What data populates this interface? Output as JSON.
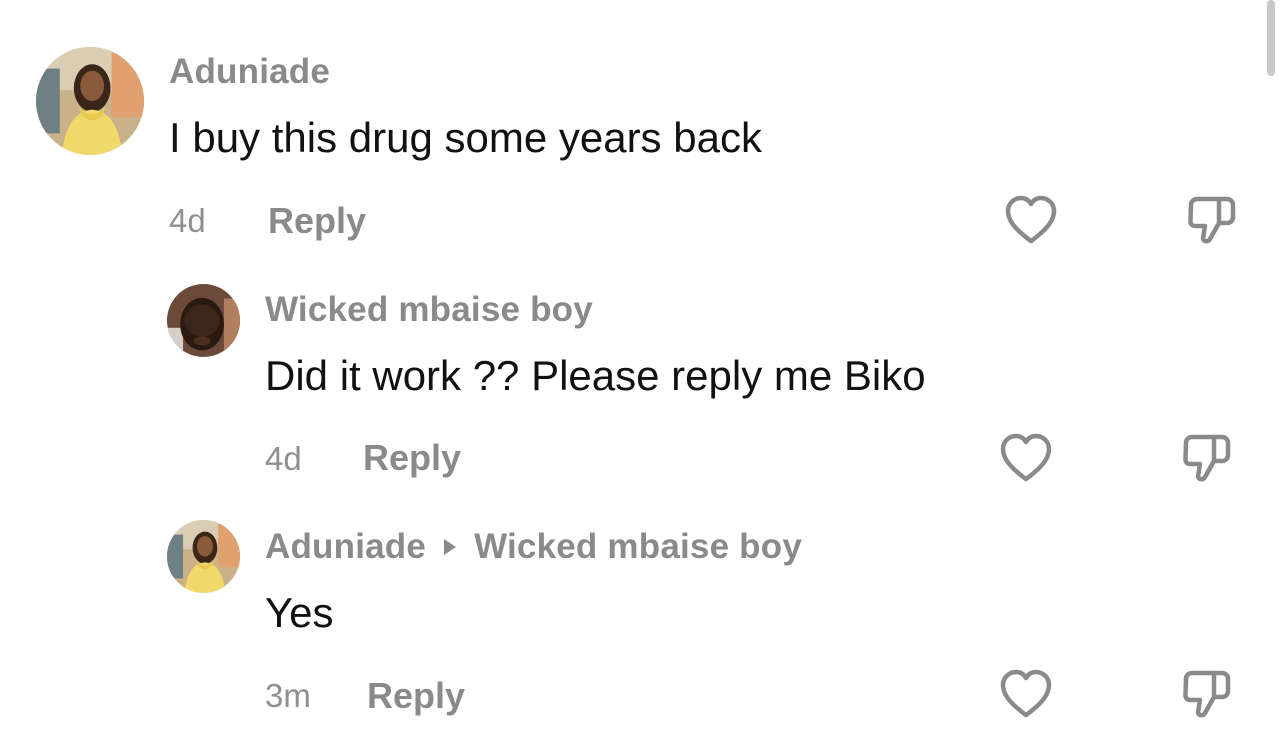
{
  "comments": [
    {
      "username": "Aduniade",
      "text": "I buy this drug some years back",
      "time": "4d",
      "reply_label": "Reply",
      "avatar": "woman-yellow-dress-avatar"
    },
    {
      "username": "Wicked mbaise boy",
      "text": "Did it work ?? Please reply me Biko",
      "time": "4d",
      "reply_label": "Reply",
      "avatar": "man-portrait-avatar"
    },
    {
      "username": "Aduniade",
      "reply_to": "Wicked mbaise boy",
      "text": "Yes",
      "time": "3m",
      "reply_label": "Reply",
      "avatar": "woman-yellow-dress-avatar"
    }
  ],
  "icons": {
    "like": "heart-outline-icon",
    "dislike": "thumbs-down-outline-icon",
    "reply_arrow": "triangle-right-icon"
  },
  "colors": {
    "background": "#ffffff",
    "username": "#8a8a8a",
    "text": "#111111",
    "meta": "#8f8f8f",
    "icon_stroke": "#8a8a8a"
  }
}
